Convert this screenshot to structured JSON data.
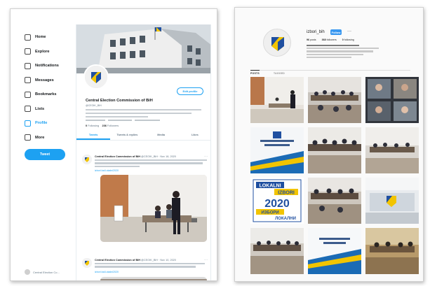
{
  "twitter": {
    "nav": [
      {
        "label": "Home",
        "icon": "home-icon"
      },
      {
        "label": "Explore",
        "icon": "hashtag-icon"
      },
      {
        "label": "Notifications",
        "icon": "bell-icon"
      },
      {
        "label": "Messages",
        "icon": "envelope-icon"
      },
      {
        "label": "Bookmarks",
        "icon": "bookmark-icon"
      },
      {
        "label": "Lists",
        "icon": "list-icon"
      },
      {
        "label": "Profile",
        "icon": "person-icon"
      },
      {
        "label": "More",
        "icon": "more-icon"
      }
    ],
    "active_nav": "Profile",
    "tweet_button": "Tweet",
    "footer_user": "Central Election Co...",
    "profile": {
      "edit_button": "Edit profile",
      "name": "Central Election Commission of BiH",
      "handle": "@CEOIK_BiH",
      "following_count": "0",
      "following_label": "Following",
      "followers_count": "236",
      "followers_label": "Followers"
    },
    "tabs": [
      "Tweets",
      "Tweets & replies",
      "Media",
      "Likes"
    ],
    "active_tab": "Tweets",
    "tweets": [
      {
        "author": "Central Election Commission of BiH",
        "handle": "@CEOIK_BiH · Nov 18, 2020",
        "link": "izbori.ba/Lokalni2020"
      },
      {
        "author": "Central Election Commission of BiH",
        "handle": "@CEOIK_BiH · Nov 10, 2020",
        "link": "izbori.ba/Lokalni2020"
      }
    ]
  },
  "instagram": {
    "username": "izbori_bih",
    "follow_button": "Follow",
    "more": "···",
    "stats": [
      {
        "count": "96",
        "label": "posts"
      },
      {
        "count": "368",
        "label": "followers"
      },
      {
        "count": "0",
        "label": "following"
      }
    ],
    "tabs": [
      "POSTS",
      "TAGGED"
    ],
    "active_tab": "POSTS",
    "posts": [
      "photo",
      "photo",
      "photo",
      "banner",
      "photo",
      "photo",
      "poster-2020",
      "photo",
      "photo",
      "photo",
      "banner",
      "photo"
    ],
    "poster": {
      "line1": "LOKALNI",
      "line2": "IZBORI",
      "year": "2020",
      "line3": "ИЗБОРИ",
      "line4": "ЛОКАЛНИ"
    }
  },
  "colors": {
    "twitter_blue": "#1da1f2",
    "instagram_blue": "#3897f0"
  }
}
